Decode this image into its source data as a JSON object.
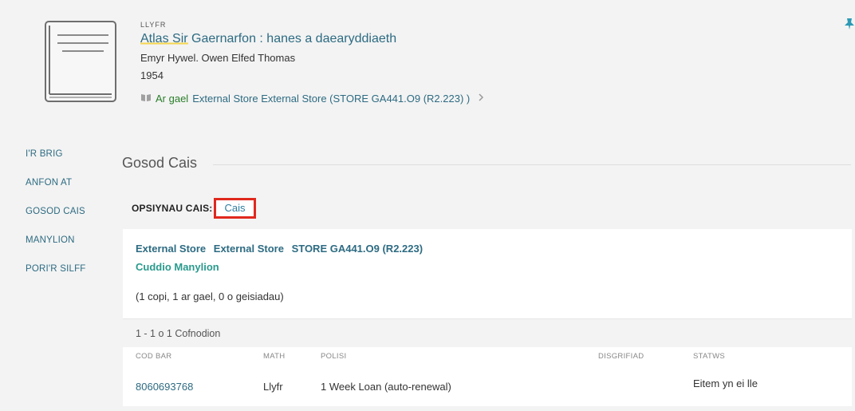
{
  "record": {
    "type": "LLYFR",
    "title_highlight": "Atlas Sir",
    "title_rest": " Gaernarfon : hanes a daearyddiaeth",
    "author": "Emyr Hywel. Owen Elfed Thomas",
    "year": "1954",
    "availability": {
      "status": "Ar gael",
      "location": "External Store  External Store (STORE GA441.O9 (R2.223) )"
    }
  },
  "sidenav": {
    "items": [
      "I'R BRIG",
      "ANFON AT",
      "GOSOD CAIS",
      "MANYLION",
      "PORI'R SILFF"
    ]
  },
  "request_section": {
    "title": "Gosod Cais",
    "options_label": "OPSIYNAU CAIS:",
    "request_link": "Cais"
  },
  "holding": {
    "library": "External Store",
    "sublocation": "External Store",
    "callnumber": "STORE GA441.O9 (R2.223)",
    "hide_details": "Cuddio Manylion",
    "copies_summary": "(1 copi, 1 ar gael, 0 o geisiadau)",
    "records_count": "1 - 1 o 1 Cofnodion",
    "columns": [
      "COD BAR",
      "MATH",
      "POLISI",
      "DISGRIFIAD",
      "STATWS"
    ],
    "items": [
      {
        "barcode": "8060693768",
        "type": "Llyfr",
        "policy": "1 Week Loan (auto-renewal)",
        "description": "",
        "status": "Eitem yn ei lle"
      }
    ]
  },
  "colors": {
    "link": "#2d6b82",
    "available": "#2a7d2a",
    "highlight_box": "#e0281d",
    "title_underline": "#f4d64e"
  },
  "icons": {
    "thumbnail": "book-cover-icon",
    "availability": "book-open-icon",
    "chevron": "chevron-right-icon",
    "pin": "pin-icon"
  }
}
